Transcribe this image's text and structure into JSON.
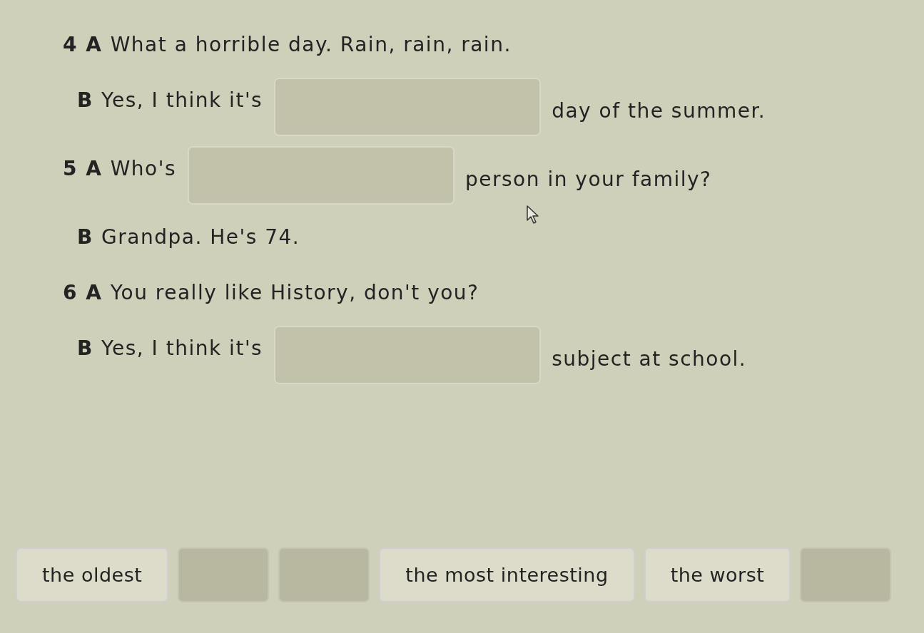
{
  "exercise": {
    "items": [
      {
        "kind": "line",
        "number": "4",
        "speaker": "A",
        "text": "What a horrible day. Rain, rain, rain."
      },
      {
        "kind": "gap",
        "speaker": "B",
        "before": "Yes, I think it's",
        "after": "day of the summer."
      },
      {
        "kind": "gap",
        "number": "5",
        "speaker": "A",
        "before": "Who's",
        "after": "person in your family?"
      },
      {
        "kind": "line",
        "speaker": "B",
        "text": "Grandpa. He's 74."
      },
      {
        "kind": "line",
        "number": "6",
        "speaker": "A",
        "text": "You really like History, don't you?"
      },
      {
        "kind": "gap",
        "speaker": "B",
        "before": "Yes, I think it's",
        "after": "subject at school."
      }
    ]
  },
  "word_bank": [
    {
      "kind": "word",
      "text": "the oldest"
    },
    {
      "kind": "used"
    },
    {
      "kind": "used"
    },
    {
      "kind": "word",
      "text": "the most interesting"
    },
    {
      "kind": "word",
      "text": "the worst"
    },
    {
      "kind": "used"
    }
  ]
}
